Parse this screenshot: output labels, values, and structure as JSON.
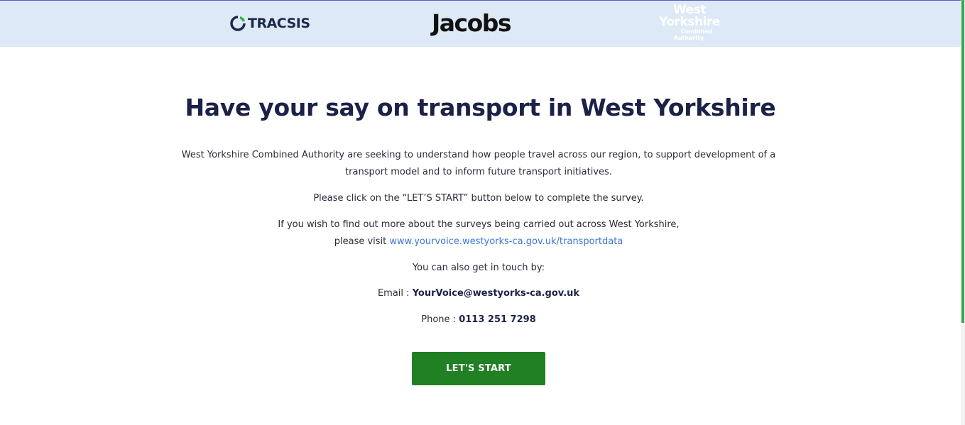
{
  "header": {
    "logos": [
      {
        "name": "tracsis-logo",
        "text": "TRACSIS"
      },
      {
        "name": "jacobs-logo",
        "text": "Jacobs"
      },
      {
        "name": "west-yorkshire-logo",
        "lines": [
          "West",
          "Yorkshire",
          "Combined",
          "Authority"
        ]
      }
    ]
  },
  "main": {
    "title": "Have your say on transport in West Yorkshire",
    "intro_line1": "West Yorkshire Combined Authority are seeking to understand how people travel across our region, to support development of a",
    "intro_line2": "transport model and to inform future transport initiatives.",
    "instruction": "Please click on the “LET’S START” button below to complete the survey.",
    "more_info_line1": "If you wish to find out more about the surveys being carried out across West Yorkshire,",
    "more_info_prefix": "please visit",
    "more_info_link": "www.yourvoice.westyorks-ca.gov.uk/transportdata",
    "contact_intro": "You can also get in touch by:",
    "email_label": "Email :",
    "email_value": "YourVoice@westyorks-ca.gov.uk",
    "phone_label": "Phone :",
    "phone_value": "0113 251 7298",
    "start_button": "LET'S START"
  },
  "colors": {
    "header_bg": "#dde9f6",
    "title": "#1b2147",
    "link": "#3a78d6",
    "button": "#217f24",
    "scroll_accent": "#3aa84a"
  }
}
